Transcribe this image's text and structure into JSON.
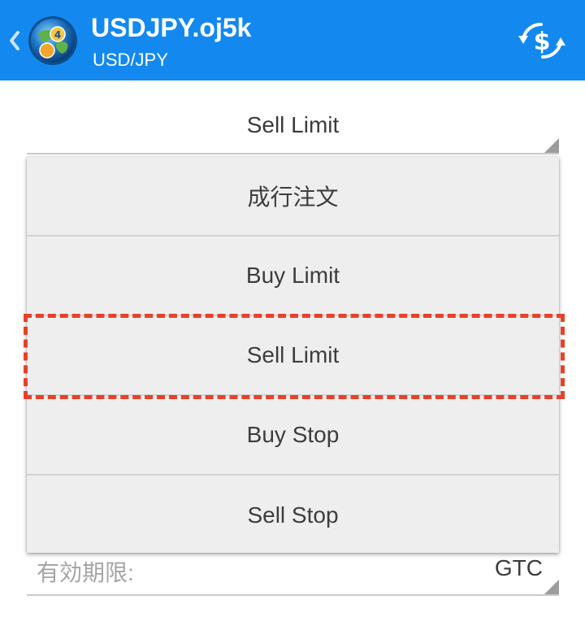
{
  "header": {
    "symbol": "USDJPY.oj5k",
    "description": "USD/JPY",
    "logo_icon": "metatrader-4-logo-icon",
    "back_icon": "chevron-left-icon",
    "trade_icon": "trade-dollar-icon",
    "background_color": "#1389f0"
  },
  "order_type": {
    "selected": "Sell Limit"
  },
  "dropdown": {
    "items": [
      {
        "label": "成行注文"
      },
      {
        "label": "Buy Limit"
      },
      {
        "label": "Sell Limit",
        "highlighted": true
      },
      {
        "label": "Buy Stop"
      },
      {
        "label": "Sell Stop"
      }
    ]
  },
  "expiration": {
    "label": "有効期限:",
    "value": "GTC"
  },
  "annotation": {
    "color": "#e8412a",
    "target": "Sell Limit"
  }
}
